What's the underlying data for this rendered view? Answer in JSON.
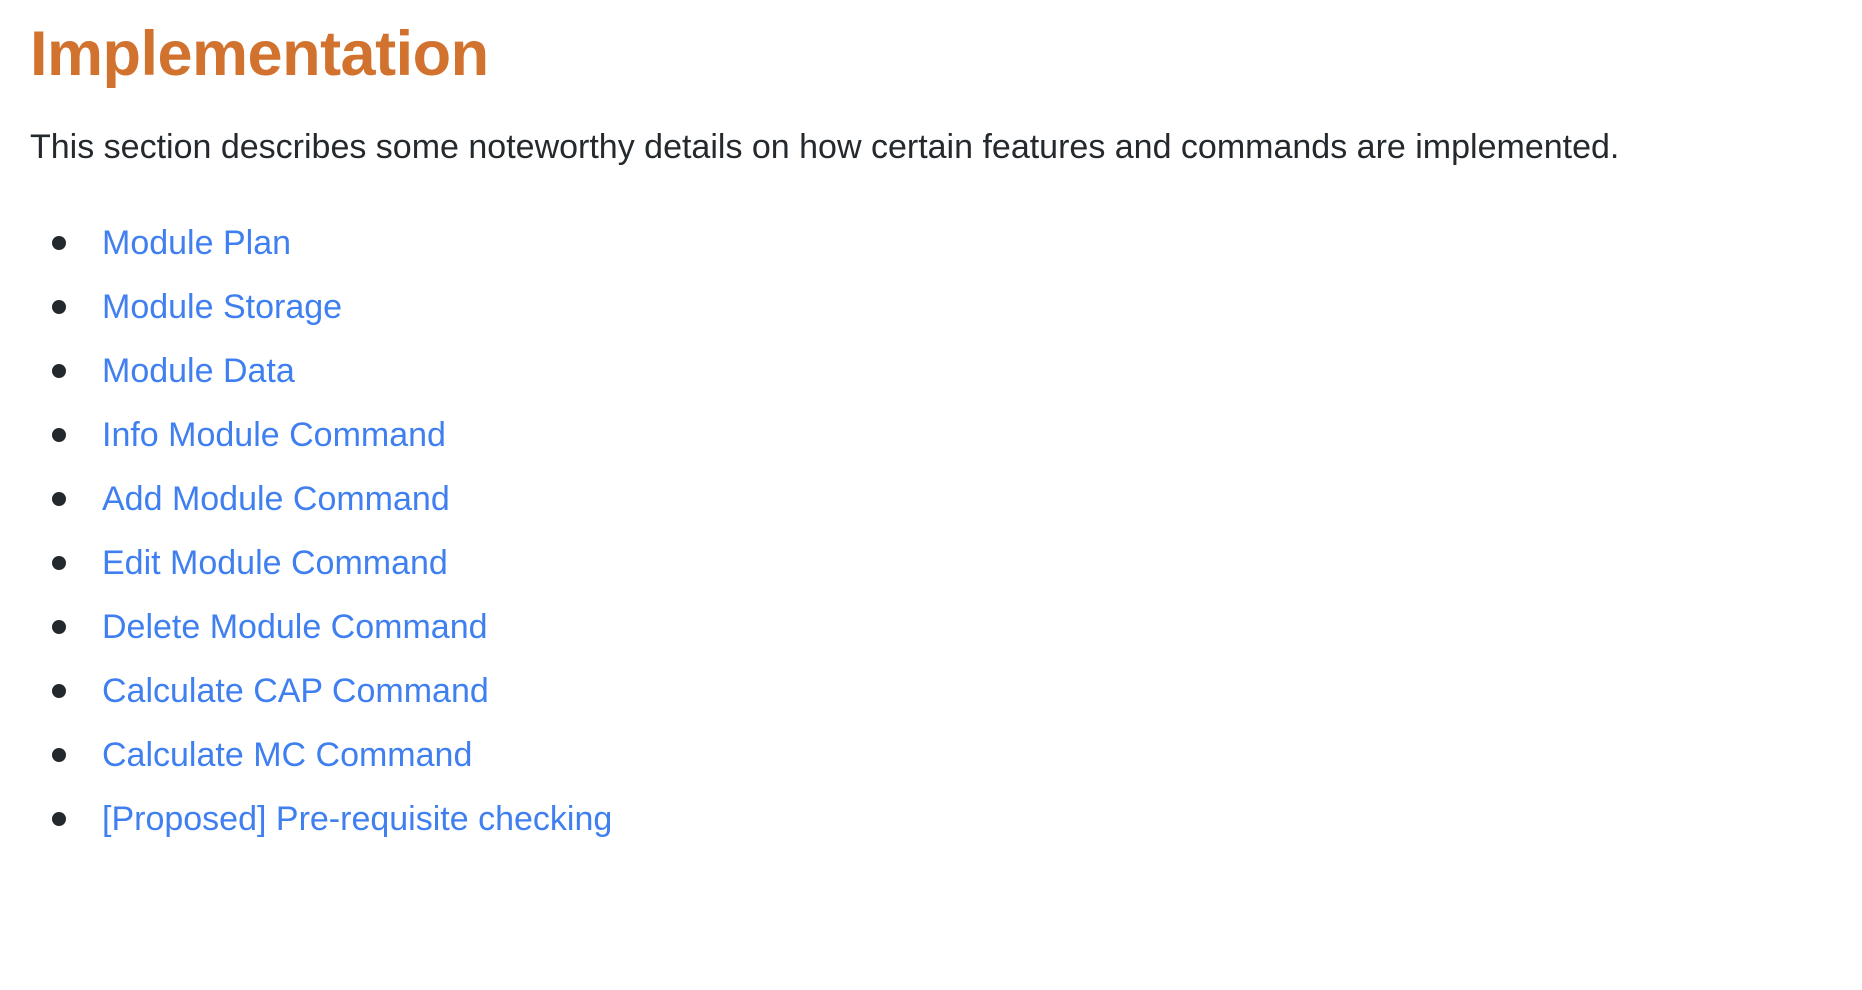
{
  "page": {
    "title": "Implementation",
    "intro": "This section describes some noteworthy details on how certain features and commands are implemented.",
    "background_color": "#ffffff",
    "heading_color": "#d1722f",
    "body_text_color": "#24292e",
    "link_color": "#3f7ff0",
    "bullet_color": "#24292e"
  },
  "toc": {
    "bullet_glyph": "•",
    "items": [
      {
        "label": "Module Plan"
      },
      {
        "label": "Module Storage"
      },
      {
        "label": "Module Data"
      },
      {
        "label": "Info Module Command"
      },
      {
        "label": "Add Module Command"
      },
      {
        "label": "Edit Module Command"
      },
      {
        "label": "Delete Module Command"
      },
      {
        "label": "Calculate CAP Command"
      },
      {
        "label": "Calculate MC Command"
      },
      {
        "label": "[Proposed] Pre-requisite checking"
      }
    ]
  }
}
